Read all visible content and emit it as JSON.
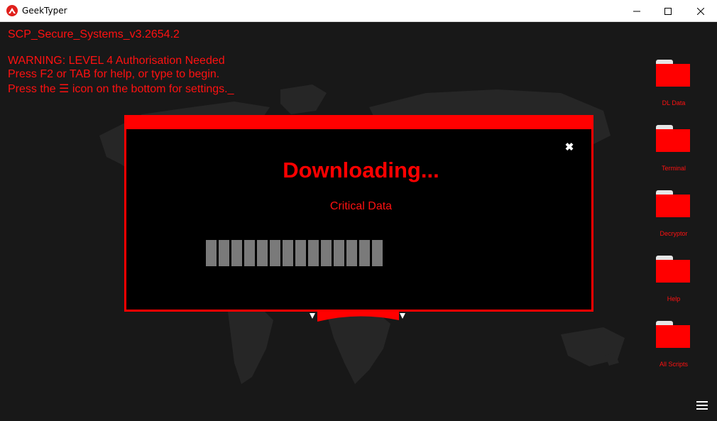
{
  "window": {
    "title": "GeekTyper",
    "icons": {
      "app": "geektyper-logo-icon",
      "minimize": "minimize-icon",
      "maximize": "maximize-icon",
      "close": "close-icon"
    }
  },
  "terminal": {
    "lines": [
      "SCP_Secure_Systems_v3.2654.2",
      "",
      "WARNING: LEVEL 4 Authorisation Needed",
      "Press F2 or TAB for help, or type to begin.",
      "Press the ☰ icon on the bottom for settings._"
    ]
  },
  "folders": [
    {
      "label": "DL Data",
      "icon": "folder-icon"
    },
    {
      "label": "Terminal",
      "icon": "folder-icon"
    },
    {
      "label": "Decryptor",
      "icon": "folder-icon"
    },
    {
      "label": "Help",
      "icon": "folder-icon"
    },
    {
      "label": "All Scripts",
      "icon": "folder-icon"
    }
  ],
  "dialog": {
    "title": "Downloading...",
    "subtitle": "Critical Data",
    "close_glyph": "✖",
    "progress_segments_filled": 14,
    "colors": {
      "accent": "#ff0000",
      "border": "#ff0000",
      "segment": "#7a7a7a",
      "background": "#000000"
    }
  },
  "settings_icon": "hamburger-menu-icon",
  "colors": {
    "text": "#ff1111",
    "desktop_bg": "#181818",
    "map": "#262626"
  }
}
